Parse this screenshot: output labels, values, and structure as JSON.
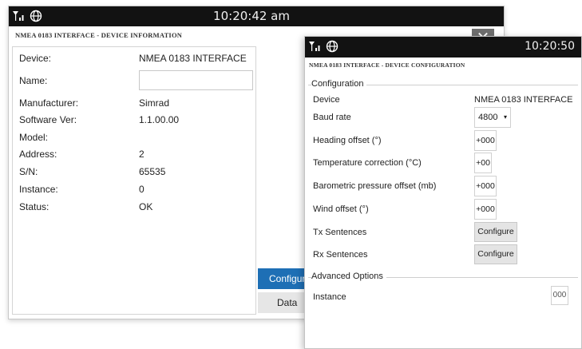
{
  "info_dialog": {
    "time": "10:20:42 am",
    "title": "NMEA 0183 INTERFACE - DEVICE INFORMATION",
    "rows": [
      {
        "label": "Device:",
        "value": "NMEA 0183 INTERFACE"
      },
      {
        "label": "Name:",
        "value": ""
      },
      {
        "label": "Manufacturer:",
        "value": "Simrad"
      },
      {
        "label": "Software Ver:",
        "value": "1.1.00.00"
      },
      {
        "label": "Model:",
        "value": ""
      },
      {
        "label": "Address:",
        "value": "2"
      },
      {
        "label": "S/N:",
        "value": "65535"
      },
      {
        "label": "Instance:",
        "value": "0"
      },
      {
        "label": "Status:",
        "value": "OK"
      }
    ],
    "configure_label": "Configure",
    "data_label": "Data"
  },
  "config_dialog": {
    "time": "10:20:50",
    "title": "NMEA 0183 INTERFACE - DEVICE CONFIGURATION",
    "section_configuration": "Configuration",
    "device_label": "Device",
    "device_value": "NMEA 0183 INTERFACE",
    "baud_label": "Baud rate",
    "baud_value": "4800",
    "heading_label": "Heading offset (°)",
    "heading_value": "+000",
    "temp_label": "Temperature correction (°C)",
    "temp_value": "+00",
    "baro_label": "Barometric pressure offset (mb)",
    "baro_value": "+000",
    "wind_label": "Wind offset (°)",
    "wind_value": "+000",
    "tx_label": "Tx Sentences",
    "rx_label": "Rx Sentences",
    "configure_button": "Configure",
    "section_advanced": "Advanced Options",
    "instance_label": "Instance",
    "instance_value": "000"
  },
  "icons": [
    "signal-icon",
    "globe-icon",
    "close-icon",
    "dropdown-caret-icon"
  ]
}
